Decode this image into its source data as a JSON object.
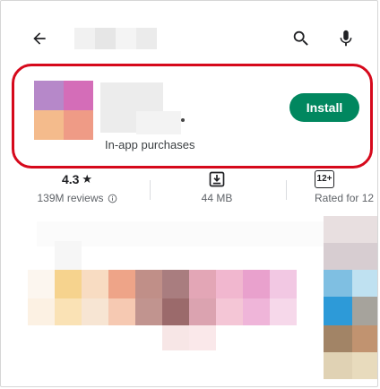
{
  "topbar": {
    "back_icon": "arrow-left-icon",
    "search_icon": "search-icon",
    "mic_icon": "microphone-icon"
  },
  "app": {
    "in_app_purchases": "In-app purchases",
    "install_label": "Install",
    "install_color": "#01875f",
    "highlight_color": "#d6091c"
  },
  "stats": {
    "rating_value": "4.3",
    "rating_star": "★",
    "reviews": "139M reviews",
    "size_value": "44 MB",
    "age_badge": "12+",
    "age_label": "Rated for 12"
  }
}
